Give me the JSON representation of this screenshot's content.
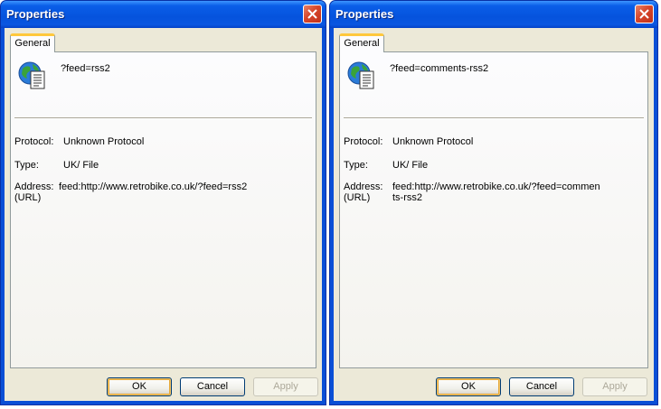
{
  "dialogs": [
    {
      "title": "Properties",
      "tab": "General",
      "file_name": "?feed=rss2",
      "protocol_label": "Protocol:",
      "protocol_value": "Unknown Protocol",
      "type_label": "Type:",
      "type_value": "UK/ File",
      "address_label": "Address:\n(URL)",
      "address_value": "feed:http://www.retrobike.co.uk/?feed=rss2",
      "ok_label": "OK",
      "cancel_label": "Cancel",
      "apply_label": "Apply"
    },
    {
      "title": "Properties",
      "tab": "General",
      "file_name": "?feed=comments-rss2",
      "protocol_label": "Protocol:",
      "protocol_value": "Unknown Protocol",
      "type_label": "Type:",
      "type_value": "UK/ File",
      "address_label": "Address:\n(URL)",
      "address_value": "feed:http://www.retrobike.co.uk/?feed=comments-rss2",
      "ok_label": "OK",
      "cancel_label": "Cancel",
      "apply_label": "Apply"
    }
  ],
  "icons": {
    "close": "close-icon",
    "file": "internet-shortcut-icon"
  },
  "colors": {
    "titlebar": "#0553dd",
    "client": "#ece9d8",
    "close_button": "#d7462a",
    "tab_highlight": "#ffc83c"
  }
}
